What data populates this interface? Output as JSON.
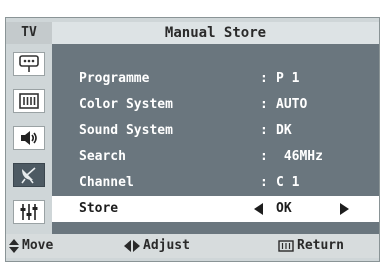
{
  "header": {
    "tv_label": "TV",
    "title": "Manual Store"
  },
  "sidebar": {
    "icons": [
      {
        "name": "input-icon"
      },
      {
        "name": "picture-icon"
      },
      {
        "name": "sound-icon"
      },
      {
        "name": "channel-antenna-icon",
        "active": true
      },
      {
        "name": "setup-sliders-icon"
      }
    ]
  },
  "menu": {
    "items": [
      {
        "label": "Programme",
        "value": "P 1"
      },
      {
        "label": "Color System",
        "value": "AUTO"
      },
      {
        "label": "Sound System",
        "value": "DK"
      },
      {
        "label": "Search",
        "value": " 46MHz"
      },
      {
        "label": "Channel",
        "value": "C 1"
      },
      {
        "label": "Store",
        "value": "OK",
        "selected": true
      }
    ],
    "separator": ":"
  },
  "footer": {
    "move_label": "Move",
    "adjust_label": "Adjust",
    "return_label": "Return"
  },
  "colors": {
    "panel": "#6a767e",
    "frame": "#cfd6d8",
    "selected_row": "#ffffff",
    "active_icon": "#4d5a63"
  }
}
